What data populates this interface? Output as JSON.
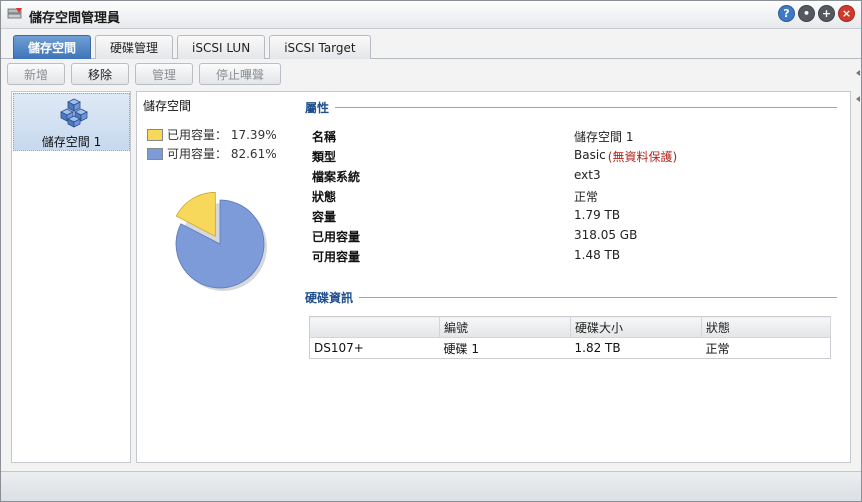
{
  "window": {
    "title": "儲存空間管理員"
  },
  "tabs": [
    {
      "label": "儲存空間",
      "active": true
    },
    {
      "label": "硬碟管理",
      "active": false
    },
    {
      "label": "iSCSI LUN",
      "active": false
    },
    {
      "label": "iSCSI Target",
      "active": false
    }
  ],
  "toolbar": {
    "add": "新增",
    "remove": "移除",
    "manage": "管理",
    "stop_beep": "停止嗶聲"
  },
  "volume_list": {
    "items": [
      {
        "label": "儲存空間 1",
        "selected": true
      }
    ]
  },
  "summary": {
    "title": "儲存空間",
    "used_label": "已用容量：",
    "used_percent": "17.39%",
    "free_label": "可用容量：",
    "free_percent": "82.61%",
    "used_color": "#f7d85a",
    "free_color": "#7d9bd9"
  },
  "chart_data": {
    "type": "pie",
    "slices": [
      {
        "label": "已用容量",
        "value": 17.39,
        "color": "#f7d85a"
      },
      {
        "label": "可用容量",
        "value": 82.61,
        "color": "#7d9bd9"
      }
    ]
  },
  "properties": {
    "heading": "屬性",
    "rows": [
      {
        "key": "名稱",
        "value": "儲存空間 1",
        "note": ""
      },
      {
        "key": "類型",
        "value": "Basic",
        "note": "(無資料保護)"
      },
      {
        "key": "檔案系統",
        "value": "ext3",
        "note": ""
      },
      {
        "key": "狀態",
        "value": "正常",
        "note": ""
      },
      {
        "key": "容量",
        "value": "1.79 TB",
        "note": ""
      },
      {
        "key": "已用容量",
        "value": "318.05 GB",
        "note": ""
      },
      {
        "key": "可用容量",
        "value": "1.48 TB",
        "note": ""
      }
    ]
  },
  "disk_info": {
    "heading": "硬碟資訊",
    "columns": [
      "",
      "編號",
      "硬碟大小",
      "狀態"
    ],
    "rows": [
      {
        "device": "DS107+",
        "id": "硬碟 1",
        "size": "1.82 TB",
        "status": "正常"
      }
    ]
  },
  "window_buttons": [
    "help-icon",
    "minimize-icon",
    "maximize-icon",
    "close-icon"
  ]
}
